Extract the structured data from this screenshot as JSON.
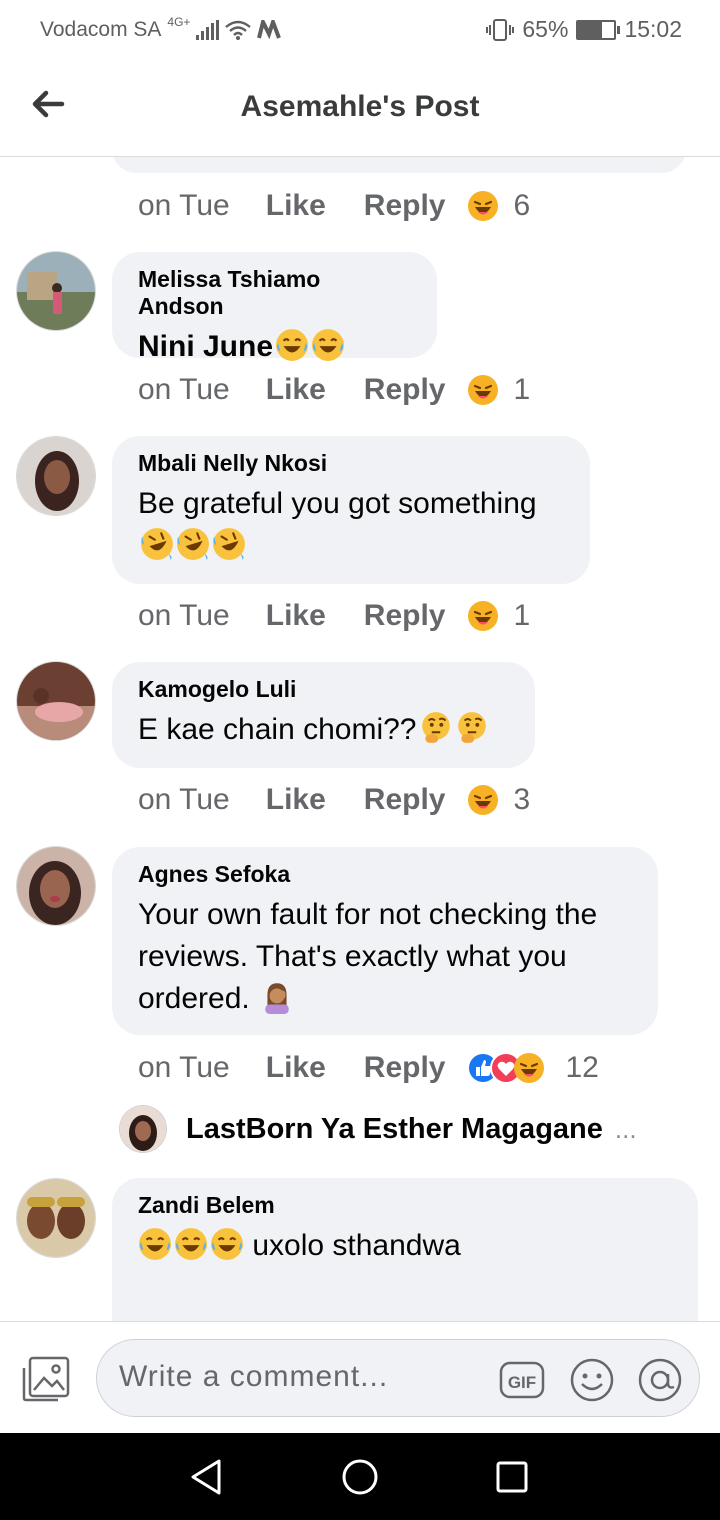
{
  "status_bar": {
    "carrier": "Vodacom SA",
    "network": "4G+",
    "battery": "65%",
    "battery_level": 0.65,
    "time": "15:02"
  },
  "header": {
    "title": "Asemahle's Post"
  },
  "previous_comment": {
    "time": "on Tue",
    "like_label": "Like",
    "reply_label": "Reply",
    "reaction_count": "6"
  },
  "comments": [
    {
      "author": "Melissa Tshiamo Andson",
      "text": "Nini June",
      "time": "on Tue",
      "like_label": "Like",
      "reply_label": "Reply",
      "reaction_count": "1"
    },
    {
      "author": "Mbali Nelly Nkosi",
      "text": "Be grateful you got something",
      "time": "on Tue",
      "like_label": "Like",
      "reply_label": "Reply",
      "reaction_count": "1"
    },
    {
      "author": "Kamogelo Luli",
      "text": "E kae chain chomi??",
      "time": "on Tue",
      "like_label": "Like",
      "reply_label": "Reply",
      "reaction_count": "3"
    },
    {
      "author": "Agnes Sefoka",
      "text": "Your own fault for not checking the reviews. That's exactly what you ordered.",
      "time": "on Tue",
      "like_label": "Like",
      "reply_label": "Reply",
      "reaction_count": "12"
    },
    {
      "author": "Zandi Belem",
      "text": "uxolo sthandwa"
    }
  ],
  "reply_preview": {
    "author": "LastBorn Ya Esther Magagane",
    "more": "..."
  },
  "composer": {
    "placeholder": "Write a comment..."
  },
  "colors": {
    "bubble": "#f0f2f5",
    "meta_text": "#65676b",
    "like_blue": "#1877f2",
    "love_red": "#f33e58",
    "haha_yellow": "#f7b125"
  },
  "icons": [
    "back-arrow-icon",
    "haha-reaction-icon",
    "like-reaction-icon",
    "love-reaction-icon",
    "photo-icon",
    "gif-icon",
    "sticker-icon",
    "mention-icon",
    "nav-back-icon",
    "nav-home-icon",
    "nav-recents-icon"
  ]
}
